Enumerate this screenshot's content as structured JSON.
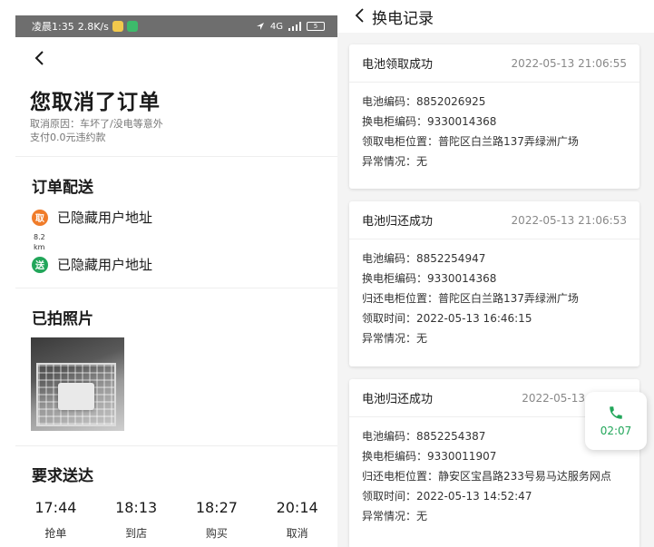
{
  "left": {
    "statusbar": {
      "time": "凌晨1:35",
      "speed": "2.8K/s",
      "signal": "4G",
      "battery": "5"
    },
    "page_title": "您取消了订单",
    "reason": "取消原因：车坏了/没电等意外",
    "penalty": "支付0.0元违约款",
    "delivery": {
      "title": "订单配送",
      "pickup_icon": "取",
      "pickup_address": "已隐藏用户地址",
      "distance_value": "8.2",
      "distance_unit": "km",
      "dropoff_icon": "送",
      "dropoff_address": "已隐藏用户地址"
    },
    "photos_title": "已拍照片",
    "required_title": "要求送达",
    "timeline": [
      {
        "time": "17:44",
        "label": "抢单"
      },
      {
        "time": "18:13",
        "label": "到店"
      },
      {
        "time": "18:27",
        "label": "购买"
      },
      {
        "time": "20:14",
        "label": "取消"
      }
    ]
  },
  "right": {
    "title": "换电记录",
    "cards": [
      {
        "status": "电池领取成功",
        "time": "2022-05-13 21:06:55",
        "lines": [
          "电池编码：8852026925",
          "换电柜编码：9330014368",
          "领取电柜位置：普陀区白兰路137弄绿洲广场",
          "异常情况：无"
        ]
      },
      {
        "status": "电池归还成功",
        "time": "2022-05-13 21:06:53",
        "lines": [
          "电池编码：8852254947",
          "换电柜编码：9330014368",
          "归还电柜位置：普陀区白兰路137弄绿洲广场",
          "领取时间：2022-05-13 16:46:15",
          "异常情况：无"
        ]
      },
      {
        "status": "电池归还成功",
        "time": "2022-05-13",
        "lines": [
          "电池编码：8852254387",
          "换电柜编码：9330011907",
          "归还电柜位置：静安区宝昌路233号易马达服务网点",
          "领取时间：2022-05-13 14:52:47",
          "异常情况：无"
        ]
      }
    ],
    "call": {
      "time": "02:07"
    }
  },
  "colors": {
    "pickup": "#f07c2a",
    "dropoff": "#22a65a",
    "call": "#22a65a"
  }
}
